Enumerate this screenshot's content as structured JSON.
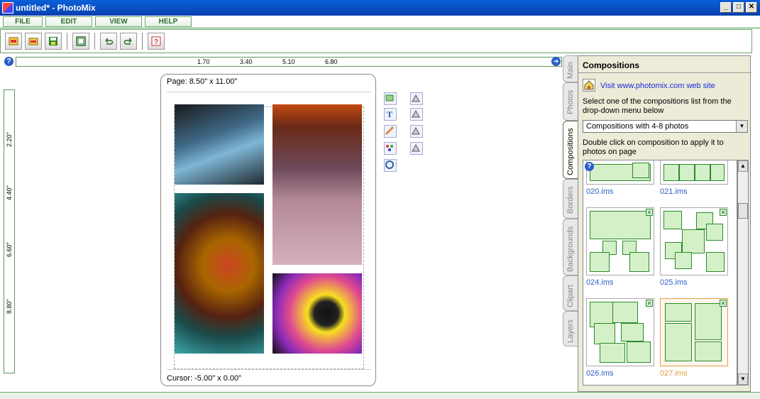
{
  "window": {
    "title": "untitled* - PhotoMix"
  },
  "menu": [
    {
      "label": "FILE"
    },
    {
      "label": "EDIT"
    },
    {
      "label": "VIEW"
    },
    {
      "label": "HELP"
    }
  ],
  "ruler": {
    "h_ticks": [
      "1.70",
      "3.40",
      "5.10",
      "6.80"
    ],
    "v_ticks": [
      "2.20\"",
      "4.40\"",
      "6.60\"",
      "8.80\""
    ]
  },
  "page": {
    "size_label": "Page: 8.50\" x 11.00\"",
    "cursor_label": "Cursor: -5.00\" x 0.00\""
  },
  "tabs": [
    "Main",
    "Photos",
    "Compositions",
    "Borders",
    "Backgrounds",
    "Clipart",
    "Layers"
  ],
  "panel": {
    "title": "Compositions",
    "visit_link": "Visit www.photomix.com web site",
    "select_text": "Select one of the compositions list from the drop-down menu below",
    "dropdown_value": "Compositions with 4-8 photos",
    "dblclick_text": "Double click on composition to apply it to photos on page",
    "compositions": [
      {
        "label": "020.ims"
      },
      {
        "label": "021.ims"
      },
      {
        "label": "024.ims"
      },
      {
        "label": "025.ims"
      },
      {
        "label": "026.ims"
      },
      {
        "label": "027.ims",
        "selected": true
      }
    ]
  },
  "colors": {
    "accent_green": "#2a8a2a",
    "link_blue": "#1a2adb",
    "selection_orange": "#e0a040"
  }
}
